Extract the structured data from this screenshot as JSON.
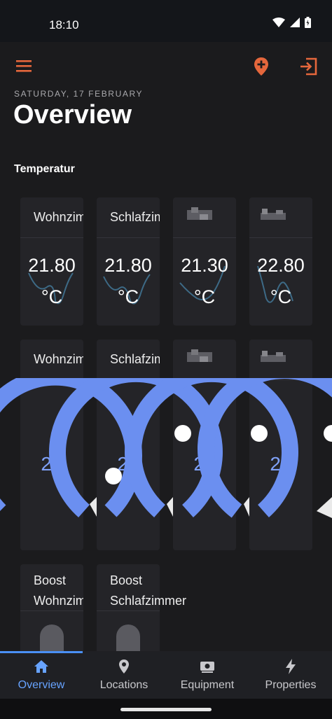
{
  "status_bar": {
    "time": "18:10"
  },
  "toolbar": {
    "menu_icon": "menu-icon",
    "add_location_icon": "add-location-icon",
    "logout_icon": "logout-icon",
    "accent": "#e5673c"
  },
  "header": {
    "date": "SATURDAY, 17 FEBRUARY",
    "title": "Overview"
  },
  "section": {
    "title": "Temperatur"
  },
  "temperature_cards": [
    {
      "title": "Wohnzimmer",
      "value": "21.80",
      "unit": "°C",
      "blurred": false
    },
    {
      "title": "Schlafzimmer",
      "value": "21.80",
      "unit": "°C",
      "blurred": false
    },
    {
      "title": "",
      "value": "21.30",
      "unit": "°C",
      "blurred": true
    },
    {
      "title": "",
      "value": "22.80",
      "unit": "°C",
      "blurred": true
    }
  ],
  "setpoint_cards": [
    {
      "title": "Wohnzimmer",
      "value": "22",
      "blurred": false
    },
    {
      "title": "Schlafzimmer",
      "value": "21",
      "blurred": false
    },
    {
      "title": "",
      "value": "21",
      "blurred": true
    },
    {
      "title": "",
      "value": "21",
      "blurred": true
    }
  ],
  "boost_cards": [
    {
      "title": "Boost Wohnzimmer"
    },
    {
      "title": "Boost Schlafzimmer"
    }
  ],
  "bottom_nav": [
    {
      "label": "Overview",
      "icon": "home-icon",
      "active": true
    },
    {
      "label": "Locations",
      "icon": "location-pin-icon",
      "active": false
    },
    {
      "label": "Equipment",
      "icon": "equipment-icon",
      "active": false
    },
    {
      "label": "Properties",
      "icon": "bolt-icon",
      "active": false
    }
  ],
  "colors": {
    "background": "#1b1b1d",
    "card": "#242428",
    "gauge": "#6b8ff0",
    "nav_active": "#67a3ff"
  }
}
